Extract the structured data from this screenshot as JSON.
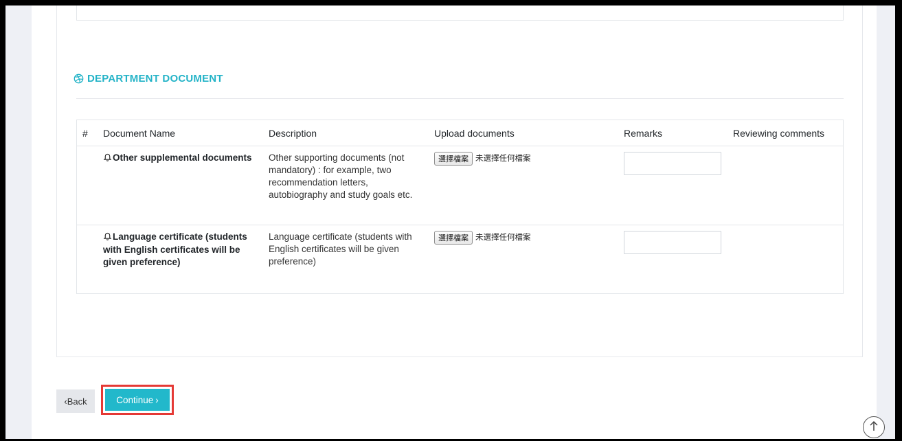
{
  "section": {
    "title": "DEPARTMENT DOCUMENT",
    "icon": "dribbble-icon",
    "accent_color": "#23b3c7"
  },
  "table": {
    "headers": {
      "num": "#",
      "name": "Document Name",
      "description": "Description",
      "upload": "Upload documents",
      "remarks": "Remarks",
      "reviewing": "Reviewing comments"
    },
    "rows": [
      {
        "name": "Other supplemental documents",
        "description": "Other supporting documents (not mandatory) : for example, two recommendation letters, autobiography and study goals etc.",
        "file_button": "選擇檔案",
        "file_status": "未選擇任何檔案",
        "remarks": "",
        "reviewing_comments": ""
      },
      {
        "name": "Language certificate (students with English certificates will be given preference)",
        "description": "Language certificate (students with English certificates will be given preference)",
        "file_button": "選擇檔案",
        "file_status": "未選擇任何檔案",
        "remarks": "",
        "reviewing_comments": ""
      }
    ]
  },
  "buttons": {
    "back_label": "‹Back",
    "continue_label": "Continue",
    "continue_arrow": "›",
    "continue_color": "#22b8cb",
    "highlight_color": "#e53935"
  },
  "scroll_top_icon": "arrow-up-circle-icon"
}
